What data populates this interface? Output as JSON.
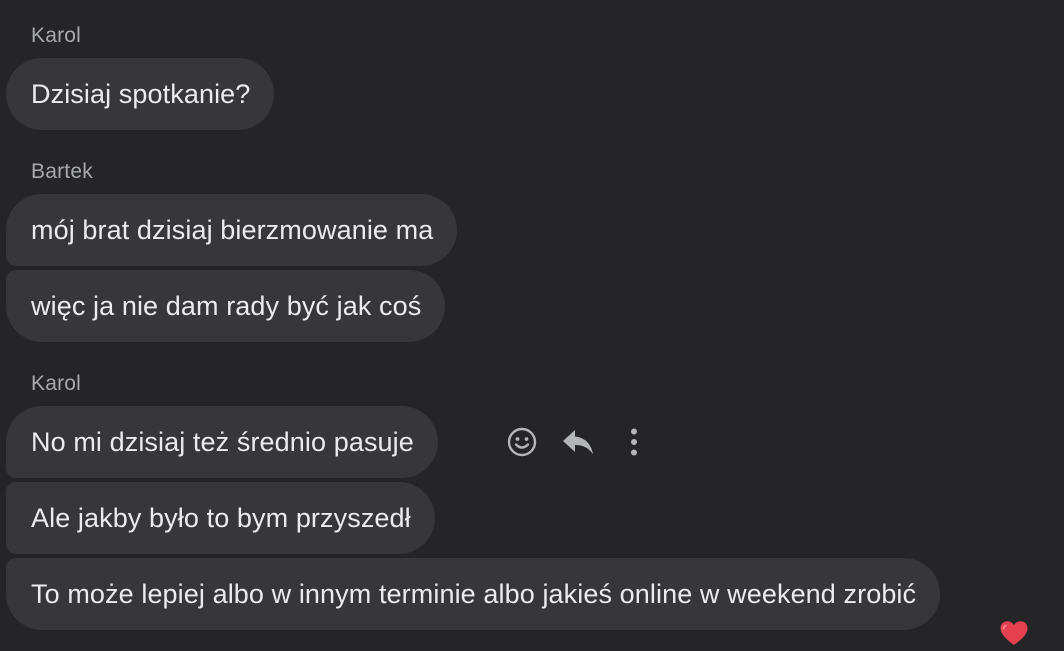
{
  "messages": [
    {
      "sender": "Karol",
      "bubbles": [
        "Dzisiaj spotkanie?"
      ]
    },
    {
      "sender": "Bartek",
      "bubbles": [
        "mój brat dzisiaj bierzmowanie ma",
        "więc ja nie dam rady być jak coś"
      ]
    },
    {
      "sender": "Karol",
      "bubbles": [
        "No mi dzisiaj też średnio pasuje",
        "Ale jakby było to bym przyszedł",
        "To może lepiej albo w innym terminie albo jakieś online w weekend zrobić"
      ]
    }
  ],
  "hover_actions": {
    "icons": [
      "smiley-icon",
      "reply-icon",
      "more-options-icon"
    ]
  },
  "reaction": {
    "icon": "heart-icon",
    "color": "#e4404f"
  },
  "colors": {
    "background": "#252527",
    "bubble": "#37373a",
    "sender_text": "#a8a9ad",
    "message_text": "#ebebed"
  }
}
